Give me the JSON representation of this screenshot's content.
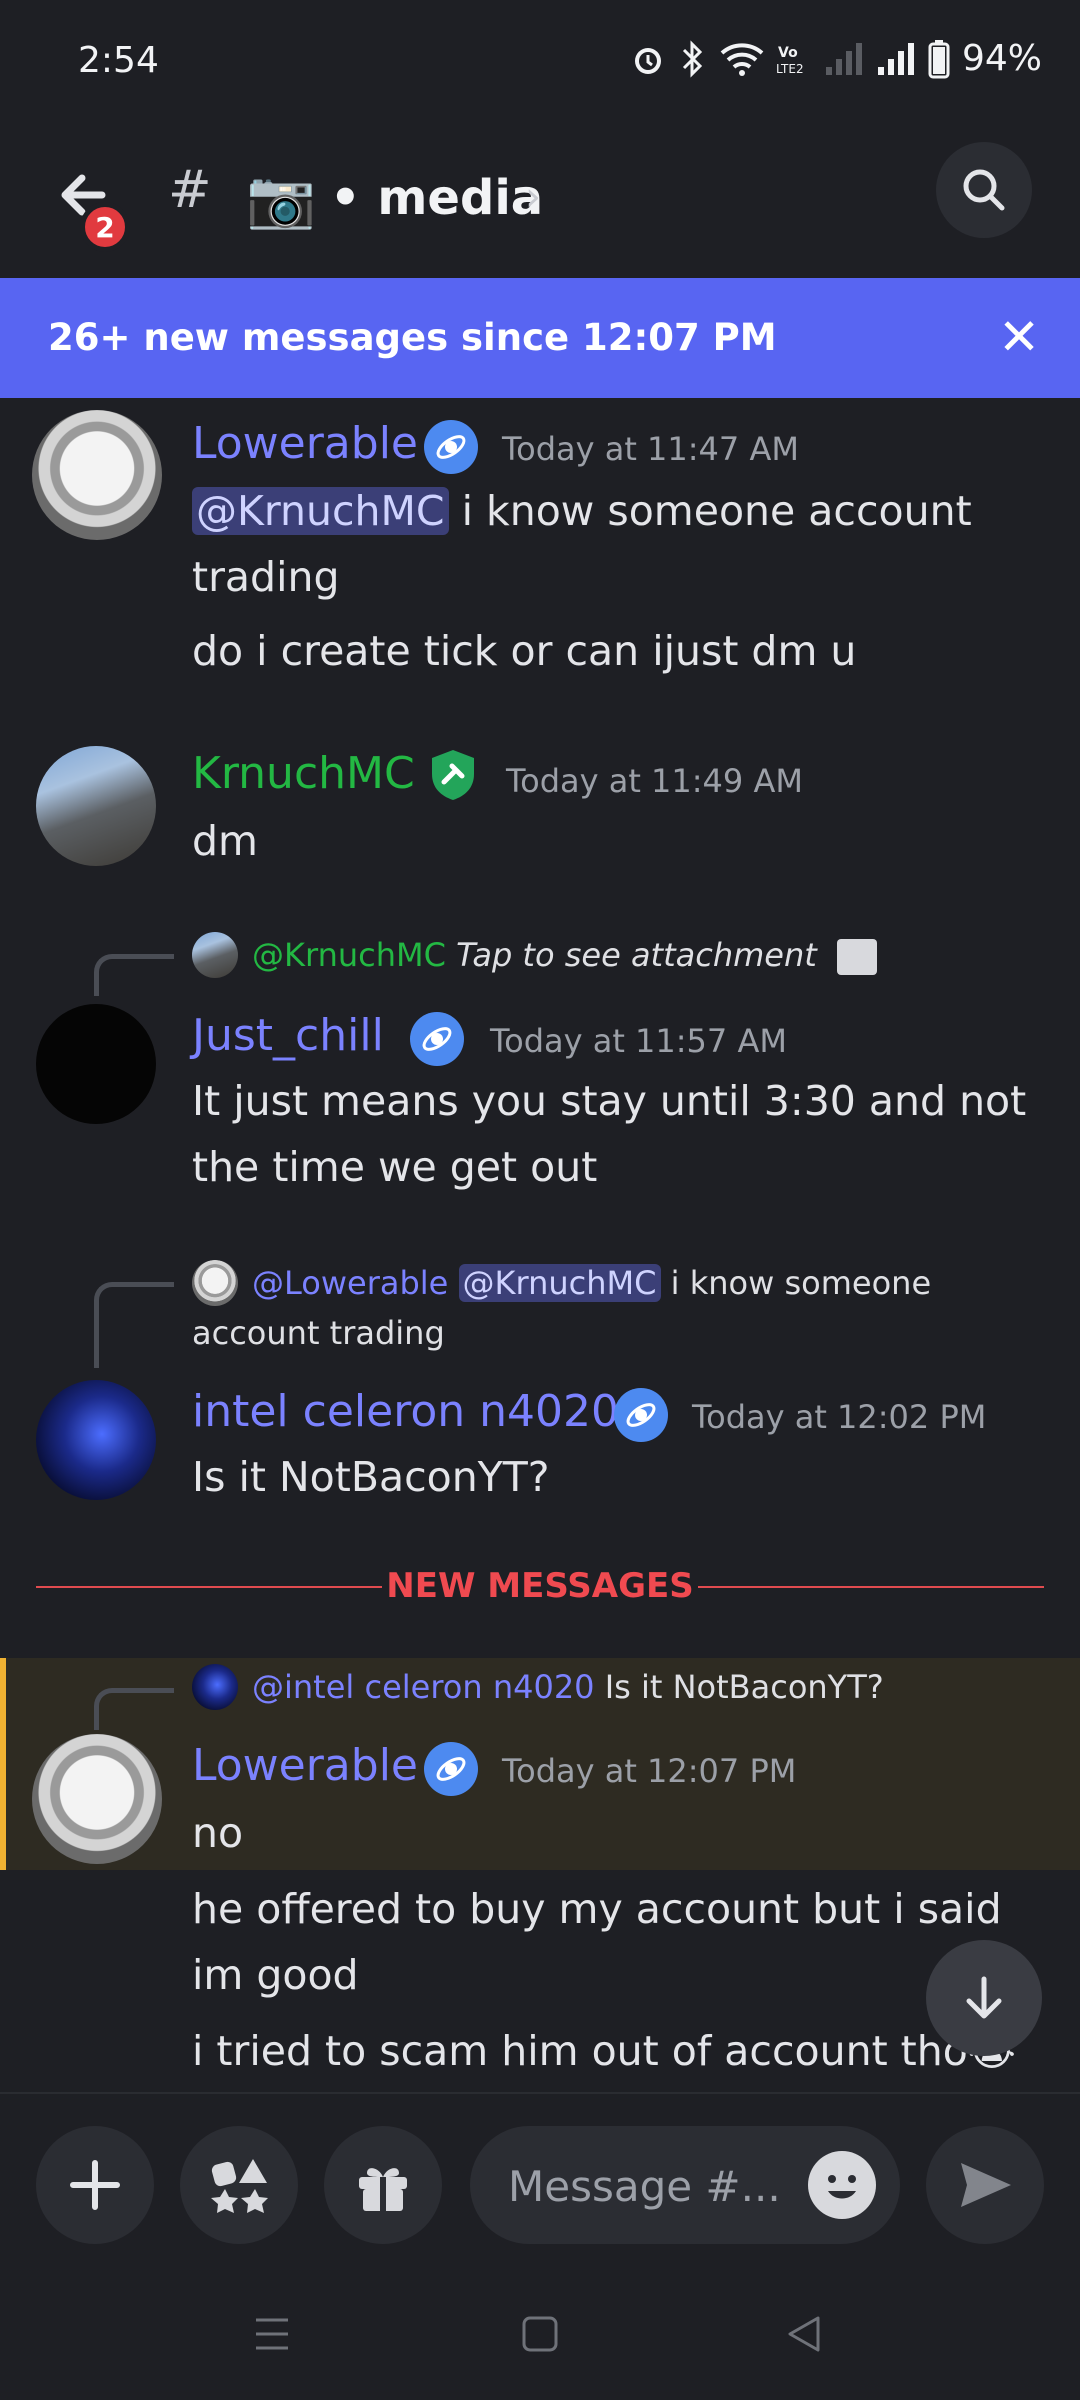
{
  "status_bar": {
    "time": "2:54",
    "battery": "94%"
  },
  "header": {
    "badge_count": "2",
    "hash": "#",
    "channel_emoji": "📷",
    "channel_name": "• media",
    "chevron": "›"
  },
  "banner": {
    "text": "26+ new messages since 12:07 PM",
    "close": "✕"
  },
  "messages": [
    {
      "username": "Lowerable",
      "timestamp": "Today at 11:47 AM",
      "mention": "@KrnuchMC",
      "line1": " i know someone account",
      "line2": "trading",
      "line3": "do i create tick or can ijust dm u"
    },
    {
      "username": "KrnuchMC",
      "timestamp": "Today at 11:49 AM",
      "line1": "dm"
    },
    {
      "reply_user": "@KrnuchMC",
      "reply_text": "Tap to see attachment",
      "username": "Just_chill",
      "timestamp": "Today at 11:57 AM",
      "line1": "It just means you stay until 3:30 and not",
      "line2": "the time we get out"
    },
    {
      "reply_user": "@Lowerable",
      "reply_mention": "@KrnuchMC",
      "reply_text": " i know someone",
      "reply_text2": "account trading",
      "username": "intel celeron n4020",
      "timestamp": "Today at 12:02 PM",
      "line1": "Is it NotBaconYT?"
    },
    {
      "reply_user": "@intel celeron n4020",
      "reply_text": "Is it NotBaconYT?",
      "username": "Lowerable",
      "timestamp": "Today at 12:07 PM",
      "line1": "no",
      "line2": "he offered to buy my account but i said",
      "line3": "im good",
      "line4": "i tried to scam him out of account tho",
      "emoji": "😭"
    }
  ],
  "divider_label": "NEW MESSAGES",
  "composer": {
    "placeholder": "Message #..."
  }
}
